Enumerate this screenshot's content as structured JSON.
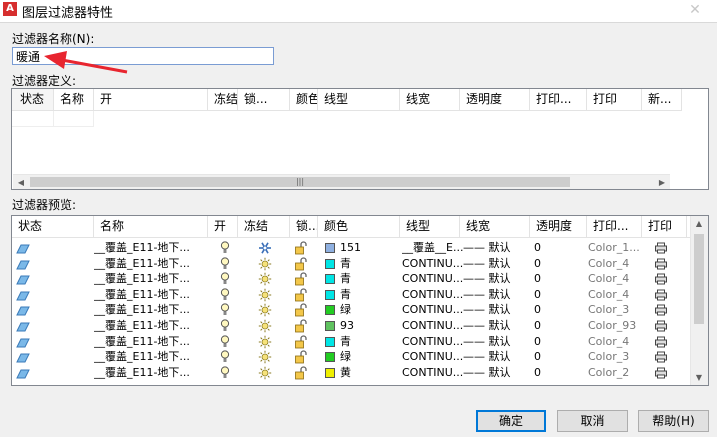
{
  "window": {
    "title": "图层过滤器特性",
    "close_glyph": "✕"
  },
  "filter_name": {
    "label": "过滤器名称(N):",
    "value": "暖通"
  },
  "definition": {
    "label": "过滤器定义:",
    "columns": [
      "状态",
      "名称",
      "开",
      "冻结",
      "锁...",
      "颜色",
      "线型",
      "线宽",
      "透明度",
      "打印...",
      "打印",
      "新..."
    ]
  },
  "preview": {
    "label": "过滤器预览:",
    "columns": [
      "状态",
      "名称",
      "开",
      "冻结",
      "锁...",
      "颜色",
      "线型",
      "线宽",
      "透明度",
      "打印...",
      "打印"
    ],
    "rows": [
      {
        "name": "__覆盖_E11-地下...",
        "color_name": "151",
        "color_hex": "#8fb0e0",
        "linetype": "__覆盖__E...",
        "lineweight": "—— 默认",
        "transparency": "0",
        "plot_style": "Color_1..."
      },
      {
        "name": "__覆盖_E11-地下...",
        "color_name": "青",
        "color_hex": "#00e5e5",
        "linetype": "CONTINU...",
        "lineweight": "—— 默认",
        "transparency": "0",
        "plot_style": "Color_4"
      },
      {
        "name": "__覆盖_E11-地下...",
        "color_name": "青",
        "color_hex": "#00e5e5",
        "linetype": "CONTINU...",
        "lineweight": "—— 默认",
        "transparency": "0",
        "plot_style": "Color_4"
      },
      {
        "name": "__覆盖_E11-地下...",
        "color_name": "青",
        "color_hex": "#00e5e5",
        "linetype": "CONTINU...",
        "lineweight": "—— 默认",
        "transparency": "0",
        "plot_style": "Color_4"
      },
      {
        "name": "__覆盖_E11-地下...",
        "color_name": "绿",
        "color_hex": "#22cc22",
        "linetype": "CONTINU...",
        "lineweight": "—— 默认",
        "transparency": "0",
        "plot_style": "Color_3"
      },
      {
        "name": "__覆盖_E11-地下...",
        "color_name": "93",
        "color_hex": "#5fc25f",
        "linetype": "CONTINU...",
        "lineweight": "—— 默认",
        "transparency": "0",
        "plot_style": "Color_93"
      },
      {
        "name": "__覆盖_E11-地下...",
        "color_name": "青",
        "color_hex": "#00e5e5",
        "linetype": "CONTINU...",
        "lineweight": "—— 默认",
        "transparency": "0",
        "plot_style": "Color_4"
      },
      {
        "name": "__覆盖_E11-地下...",
        "color_name": "绿",
        "color_hex": "#22cc22",
        "linetype": "CONTINU...",
        "lineweight": "—— 默认",
        "transparency": "0",
        "plot_style": "Color_3"
      },
      {
        "name": "__覆盖_E11-地下...",
        "color_name": "黄",
        "color_hex": "#f0f000",
        "linetype": "CONTINU...",
        "lineweight": "—— 默认",
        "transparency": "0",
        "plot_style": "Color_2"
      }
    ]
  },
  "buttons": {
    "ok": "确定",
    "cancel": "取消",
    "help": "帮助(H)"
  }
}
